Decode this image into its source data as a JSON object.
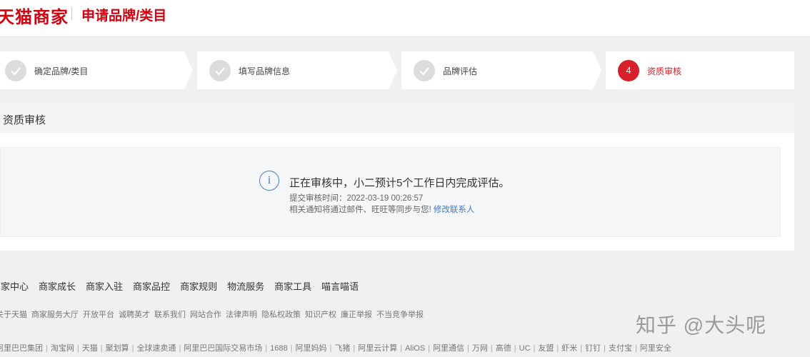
{
  "header": {
    "brand": "天猫商家",
    "title": "申请品牌/类目"
  },
  "steps": [
    {
      "label": "确定品牌/类目",
      "state": "done",
      "icon": "check-icon"
    },
    {
      "label": "填写品牌信息",
      "state": "done",
      "icon": "check-icon"
    },
    {
      "label": "品牌评估",
      "state": "done",
      "icon": "check-icon"
    },
    {
      "label": "资质审核",
      "state": "active",
      "number": "4"
    }
  ],
  "panel": {
    "title": "资质审核",
    "info_icon": "info-icon",
    "message": "正在审核中，小二预计5个工作日内完成评估。",
    "submit_time": "提交审核时间：2022-03-19 00:26:57",
    "note": "相关通知将通过邮件、旺旺等同步与您!",
    "contact_link": "修改联系人"
  },
  "footer": {
    "nav": [
      "商家中心",
      "商家成长",
      "商家入驻",
      "商家品控",
      "商家规则",
      "物流服务",
      "商家工具",
      "喵言喵语"
    ],
    "links": [
      "关于天猫",
      "商家服务大厅",
      "开放平台",
      "诚聘英才",
      "联系我们",
      "网站合作",
      "法律声明",
      "隐私权政策",
      "知识产权",
      "廉正举报",
      "不当竞争举报"
    ],
    "partners": [
      "阿里巴巴集团",
      "淘宝网",
      "天猫",
      "聚划算",
      "全球速卖通",
      "阿里巴巴国际交易市场",
      "1688",
      "阿里妈妈",
      "飞猪",
      "阿里云计算",
      "AliOS",
      "阿里通信",
      "万网",
      "高德",
      "UC",
      "友盟",
      "虾米",
      "钉钉",
      "支付宝",
      "阿里安全"
    ]
  },
  "watermark": "知乎 @大头呢",
  "colors": {
    "accent": "#d6000f",
    "link": "#3f7ec9",
    "done_circle": "#dcdcdc"
  }
}
